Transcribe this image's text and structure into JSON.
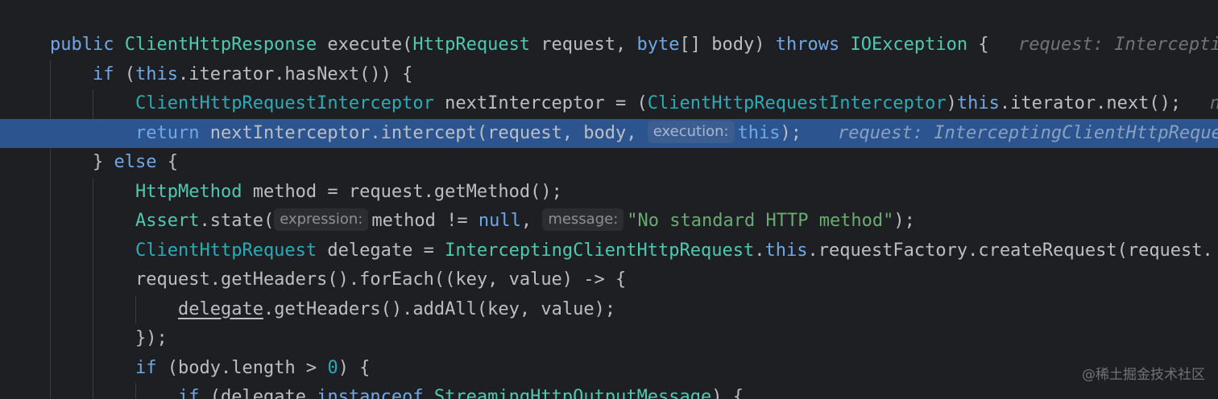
{
  "editor": {
    "colors": {
      "background": "#1e1f22",
      "current_line": "#2c558f",
      "keyword": "#cf8e6d",
      "type": "#4ec9b0",
      "string": "#6aab73"
    },
    "lines": {
      "l1": {
        "t1": "public ",
        "t2": "ClientHttpResponse ",
        "t3": "execute(",
        "t4": "HttpRequest ",
        "t5": "request, ",
        "t6": "byte",
        "t7": "[] body) ",
        "t8": "throws ",
        "t9": "IOException ",
        "t10": "{",
        "inlay": "request: Intercepti"
      },
      "l2": {
        "t1": "if ",
        "t2": "(",
        "t3": "this",
        "t4": ".iterator.hasNext()) {"
      },
      "l3": {
        "t1": "ClientHttpRequestInterceptor ",
        "t2": "nextInterceptor = (",
        "t3": "ClientHttpRequestInterceptor",
        "t4": ")",
        "t5": "this",
        "t6": ".iterator.next();",
        "inlay": "n"
      },
      "l4": {
        "t1": "return ",
        "t2": "nextInterceptor.intercept(request, body, ",
        "hint": "execution:",
        "t3": "this",
        "t4": ");",
        "inlay": "request: InterceptingClientHttpReque"
      },
      "l5": {
        "t1": "} ",
        "t2": "else ",
        "t3": "{"
      },
      "l6": {
        "t1": "HttpMethod ",
        "t2": "method = request.getMethod();"
      },
      "l7": {
        "t1": "Assert",
        "t2": ".state(",
        "hint1": "expression:",
        "t3": "method != ",
        "t4": "null",
        "t5": ", ",
        "hint2": "message:",
        "t6": "\"No standard HTTP method\"",
        "t7": ");"
      },
      "l8": {
        "t1": "ClientHttpRequest ",
        "t2": "delegate = ",
        "t3": "InterceptingClientHttpRequest",
        "t4": ".",
        "t5": "this",
        "t6": ".requestFactory.createRequest(request."
      },
      "l9": {
        "t1": "request.getHeaders().forEach((key, value) -> {"
      },
      "l10": {
        "t1": "delegate",
        "t2": ".getHeaders().addAll(key, value);"
      },
      "l11": {
        "t1": "});"
      },
      "l12": {
        "t1": "if ",
        "t2": "(body.length > ",
        "t3": "0",
        "t4": ") {"
      },
      "l13": {
        "t1": "if ",
        "t2": "(delegate ",
        "t3": "instanceof ",
        "t4": "StreamingHttpOutputMessage",
        "t5": ") {"
      }
    }
  },
  "watermark": "@稀土掘金技术社区"
}
